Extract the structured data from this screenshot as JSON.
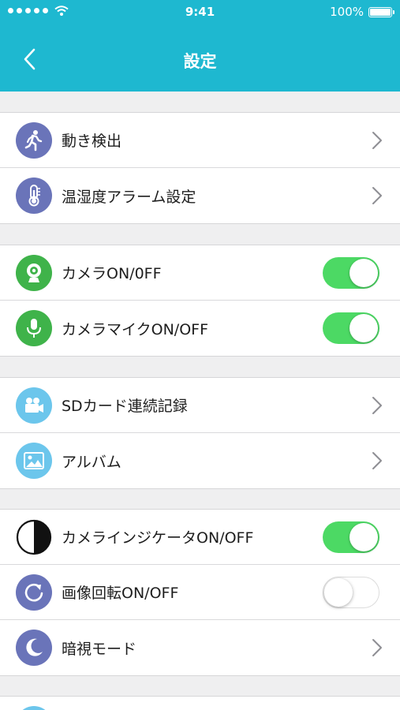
{
  "status_bar": {
    "time": "9:41",
    "battery": "100%"
  },
  "nav": {
    "title": "設定"
  },
  "colors": {
    "accent": "#1eb8d0",
    "toggle_on": "#4cd964",
    "icon_purple": "#6a74b9",
    "icon_green": "#3fb34a",
    "icon_blue": "#6cc6ec"
  },
  "sections": [
    {
      "items": [
        {
          "label": "動き検出",
          "icon": "walking-person-icon",
          "control": "chevron"
        },
        {
          "label": "温湿度アラーム設定",
          "icon": "thermometer-icon",
          "control": "chevron"
        }
      ]
    },
    {
      "items": [
        {
          "label": "カメラON/0FF",
          "icon": "webcam-icon",
          "control": "toggle",
          "state": "on"
        },
        {
          "label": "カメラマイクON/OFF",
          "icon": "microphone-icon",
          "control": "toggle",
          "state": "on"
        }
      ]
    },
    {
      "items": [
        {
          "label": "SDカード連続記録",
          "icon": "video-camera-icon",
          "control": "chevron"
        },
        {
          "label": "アルバム",
          "icon": "picture-icon",
          "control": "chevron"
        }
      ]
    },
    {
      "items": [
        {
          "label": "カメラインジケータON/OFF",
          "icon": "half-circle-icon",
          "control": "toggle",
          "state": "on"
        },
        {
          "label": "画像回転ON/OFF",
          "icon": "rotate-icon",
          "control": "toggle",
          "state": "off"
        },
        {
          "label": "暗視モード",
          "icon": "moon-icon",
          "control": "chevron"
        }
      ]
    }
  ]
}
